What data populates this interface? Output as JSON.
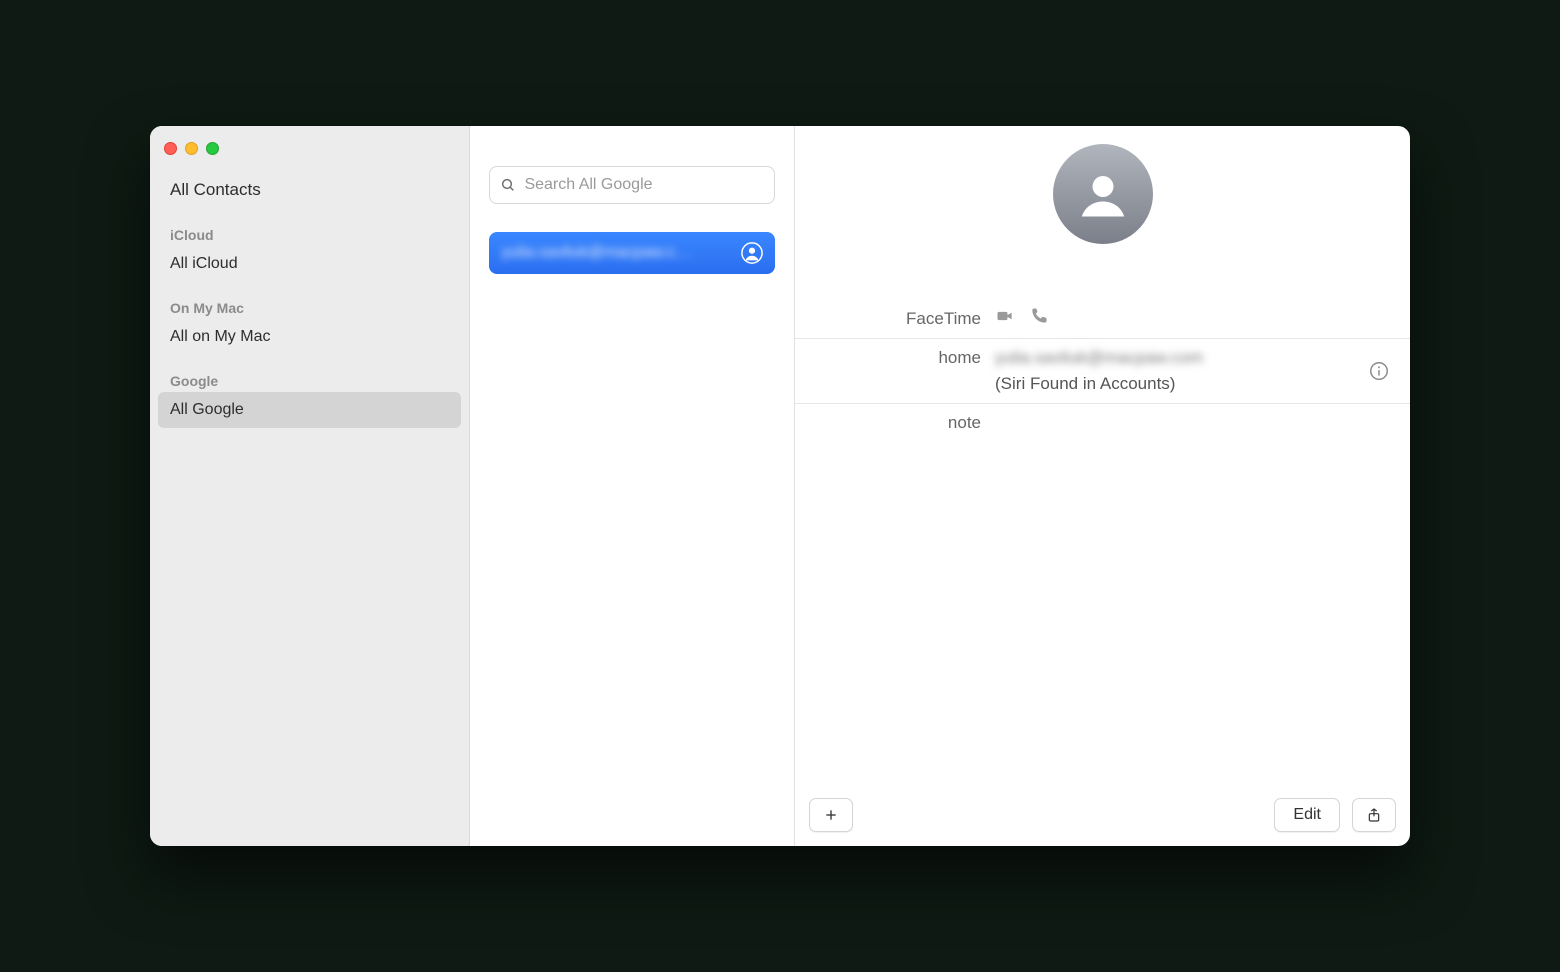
{
  "sidebar": {
    "top_item": "All Contacts",
    "sections": [
      {
        "header": "iCloud",
        "item": "All iCloud"
      },
      {
        "header": "On My Mac",
        "item": "All on My Mac"
      },
      {
        "header": "Google",
        "item": "All Google"
      }
    ],
    "selected": "All Google"
  },
  "search": {
    "placeholder": "Search All Google"
  },
  "contact_list": {
    "items": [
      {
        "name": "yulia.savliuk@macpaw.c…",
        "selected": true
      }
    ]
  },
  "detail": {
    "facetime_label": "FaceTime",
    "email": {
      "label": "home",
      "value": "yulia.savliuk@macpaw.com",
      "subtext": "(Siri Found in Accounts)"
    },
    "note_label": "note"
  },
  "footer": {
    "edit": "Edit"
  }
}
